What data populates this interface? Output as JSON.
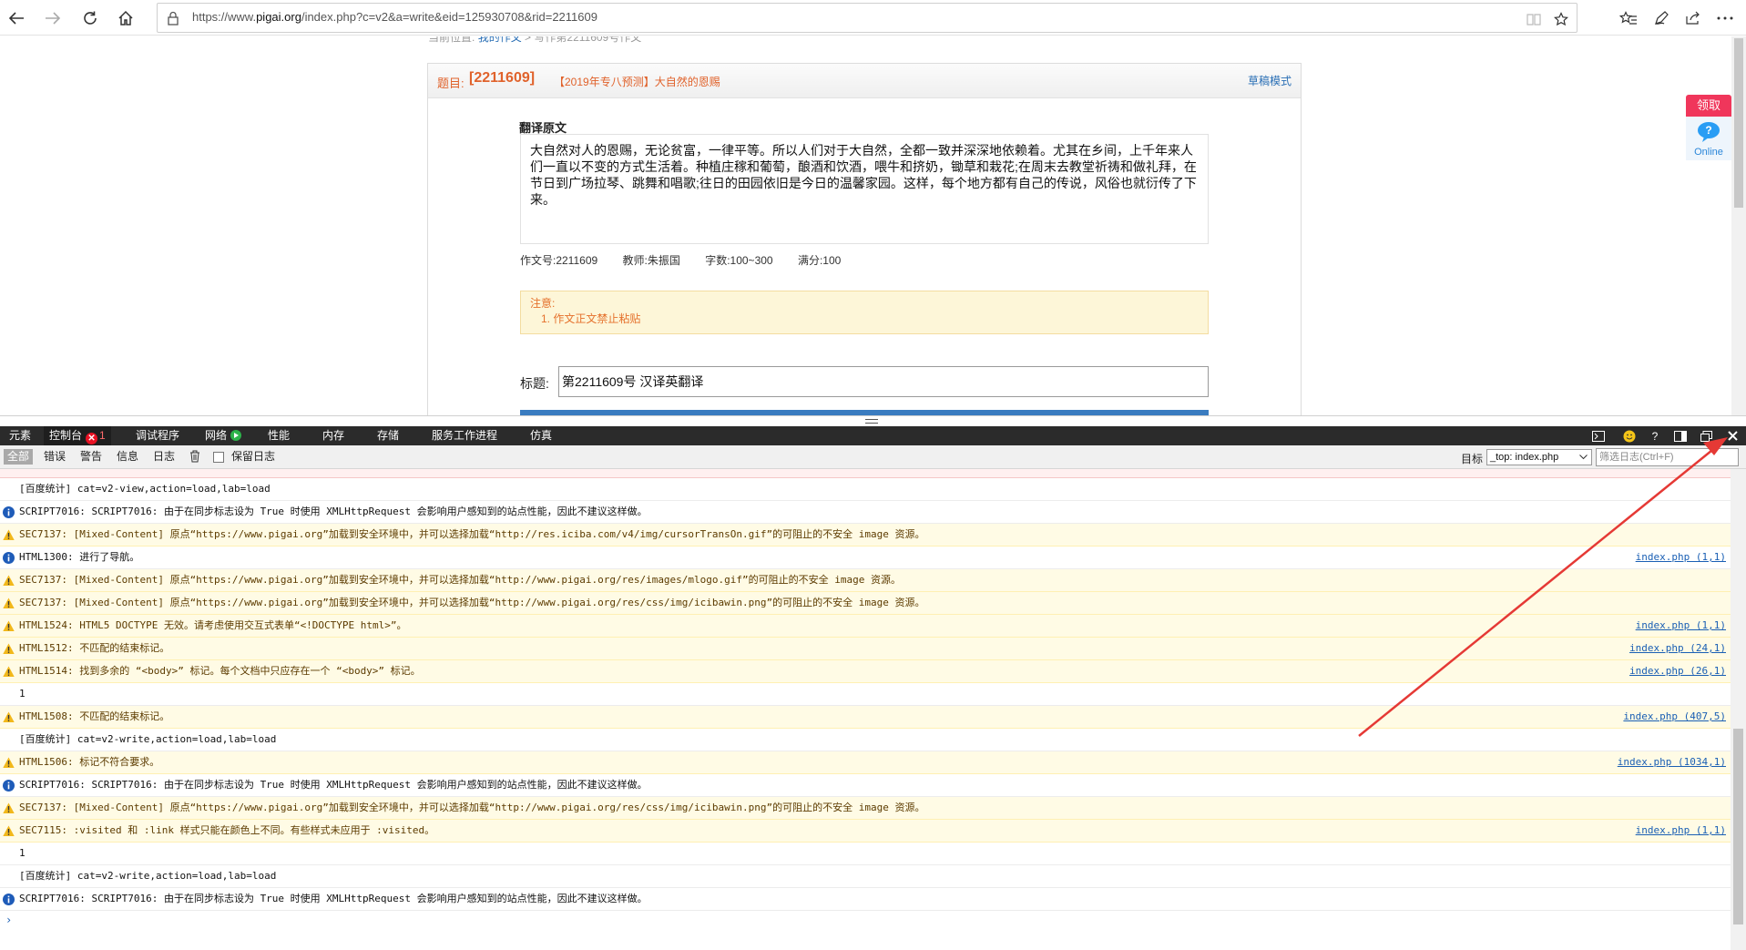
{
  "browser": {
    "url_prefix": "https://www.",
    "url_domain": "pigai.org",
    "url_rest": "/index.php?c=v2&a=write&eid=125930708&rid=2211609"
  },
  "page": {
    "breadcrumb_text": "当前位置:",
    "breadcrumb_link": "我的作文",
    "breadcrumb_rest": "> 写作第2211609号作文",
    "panel": {
      "label": "题目:",
      "code": "[2211609]",
      "title": "【2019年专八预测】大自然的恩赐",
      "draft_mode": "草稿模式"
    },
    "original_label": "翻译原文",
    "original_text": "大自然对人的恩赐，无论贫富，一律平等。所以人们对于大自然，全都一致并深深地依赖着。尤其在乡间，上千年来人们一直以不变的方式生活着。种植庄稼和葡萄，酿酒和饮酒，喂牛和挤奶，锄草和栽花;在周末去教堂祈祷和做礼拜，在节日到广场拉琴、跳舞和唱歌;往日的田园依旧是今日的温馨家园。这样，每个地方都有自己的传说，风俗也就衍传了下来。",
    "meta": {
      "essay_no": "作文号:2211609",
      "teacher": "教师:朱振国",
      "word_count": "字数:100~300",
      "full_score": "满分:100"
    },
    "notice": {
      "title": "注意:",
      "item": "1.  作文正文禁止粘贴"
    },
    "title_label": "标题:",
    "title_value": "第2211609号 汉译英翻译",
    "widget": {
      "get": "领取",
      "online": "Online"
    }
  },
  "devtools": {
    "tabs": [
      "元素",
      "控制台",
      "调试程序",
      "网络",
      "性能",
      "内存",
      "存储",
      "服务工作进程",
      "仿真"
    ],
    "error_count": "1",
    "filters": [
      "全部",
      "错误",
      "警告",
      "信息",
      "日志"
    ],
    "keep_log": "保留日志",
    "target_label": "目标",
    "target_value": "_top: index.php",
    "filter_placeholder": "筛选日志(Ctrl+F)",
    "rows": [
      {
        "type": "plain",
        "msg": "[百度统计] cat=v2-view,action=load,lab=load",
        "src": ""
      },
      {
        "type": "info",
        "msg": "SCRIPT7016: SCRIPT7016: 由于在同步标志设为 True 时使用 XMLHttpRequest 会影响用户感知到的站点性能，因此不建议这样做。",
        "src": ""
      },
      {
        "type": "warn",
        "msg": "SEC7137: [Mixed-Content] 原点“https://www.pigai.org”加载到安全环境中，并可以选择加载“http://res.iciba.com/v4/img/cursorTransOn.gif”的可阻止的不安全 image 资源。",
        "src": ""
      },
      {
        "type": "info",
        "msg": "HTML1300: 进行了导航。",
        "src": "index.php (1,1)"
      },
      {
        "type": "warn",
        "msg": "SEC7137: [Mixed-Content] 原点“https://www.pigai.org”加载到安全环境中，并可以选择加载“http://www.pigai.org/res/images/mlogo.gif”的可阻止的不安全 image 资源。",
        "src": ""
      },
      {
        "type": "warn",
        "msg": "SEC7137: [Mixed-Content] 原点“https://www.pigai.org”加载到安全环境中，并可以选择加载“http://www.pigai.org/res/css/img/icibawin.png”的可阻止的不安全 image 资源。",
        "src": ""
      },
      {
        "type": "warn",
        "msg": "HTML1524: HTML5 DOCTYPE 无效。请考虑使用交互式表单“<!DOCTYPE html>”。",
        "src": "index.php (1,1)"
      },
      {
        "type": "warn",
        "msg": "HTML1512: 不匹配的结束标记。",
        "src": "index.php (24,1)"
      },
      {
        "type": "warn",
        "msg": "HTML1514: 找到多余的 “<body>” 标记。每个文档中只应存在一个 “<body>” 标记。",
        "src": "index.php (26,1)"
      },
      {
        "type": "plain",
        "msg": "1",
        "src": ""
      },
      {
        "type": "warn",
        "msg": "HTML1508: 不匹配的结束标记。",
        "src": "index.php (407,5)"
      },
      {
        "type": "plain",
        "msg": "[百度统计] cat=v2-write,action=load,lab=load",
        "src": ""
      },
      {
        "type": "warn",
        "msg": "HTML1506: 标记不符合要求。",
        "src": "index.php (1034,1)"
      },
      {
        "type": "info",
        "msg": "SCRIPT7016: SCRIPT7016: 由于在同步标志设为 True 时使用 XMLHttpRequest 会影响用户感知到的站点性能，因此不建议这样做。",
        "src": ""
      },
      {
        "type": "warn",
        "msg": "SEC7137: [Mixed-Content] 原点“https://www.pigai.org”加载到安全环境中，并可以选择加载“http://www.pigai.org/res/css/img/icibawin.png”的可阻止的不安全 image 资源。",
        "src": ""
      },
      {
        "type": "warn",
        "msg": "SEC7115: :visited 和 :link 样式只能在颜色上不同。有些样式未应用于 :visited。",
        "src": "index.php (1,1)"
      },
      {
        "type": "plain",
        "msg": "1",
        "src": ""
      },
      {
        "type": "plain",
        "msg": "[百度统计] cat=v2-write,action=load,lab=load",
        "src": ""
      },
      {
        "type": "info",
        "msg": "SCRIPT7016: SCRIPT7016: 由于在同步标志设为 True 时使用 XMLHttpRequest 会影响用户感知到的站点性能，因此不建议这样做。",
        "src": ""
      }
    ],
    "prompt": "›"
  },
  "colors": {
    "accent_orange": "#e0622b",
    "link_blue": "#1a5fb4",
    "devtools_dark": "#2b2b2b",
    "warn_bg": "#fffbe5",
    "annotation_red": "#e53935"
  },
  "icons": {
    "back": "arrow-left-icon",
    "forward": "arrow-right-icon",
    "refresh": "refresh-icon",
    "home": "home-icon",
    "lock": "lock-icon",
    "reading": "reading-view-icon",
    "favorite": "star-icon",
    "favorites": "favorites-icon",
    "notes": "pen-icon",
    "share": "share-icon",
    "more": "more-icon",
    "close": "close-icon"
  }
}
